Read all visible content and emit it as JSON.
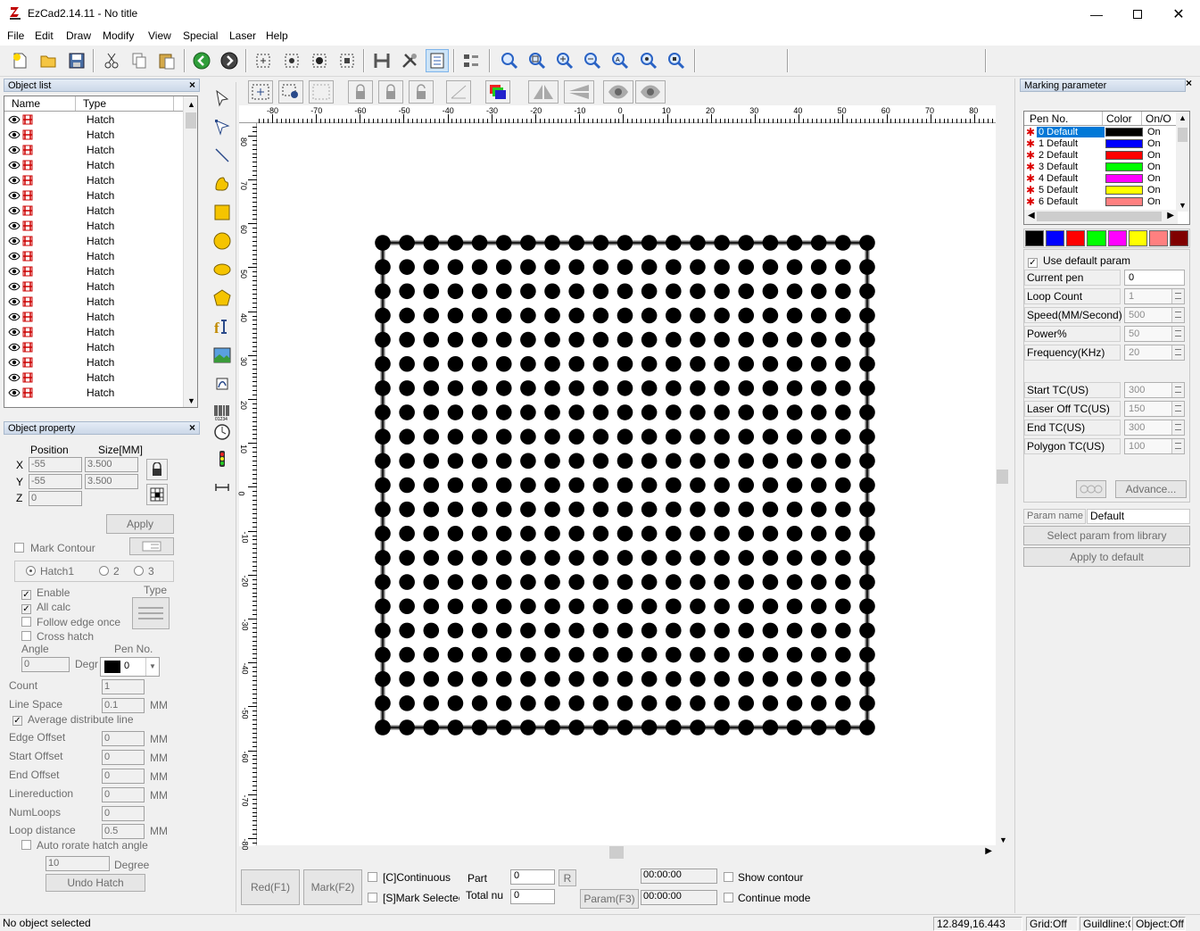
{
  "app": {
    "title": "EzCad2.14.11 - No title"
  },
  "menu": [
    "File",
    "Edit",
    "Draw",
    "Modify",
    "View",
    "Special",
    "Laser",
    "Help"
  ],
  "object_list": {
    "title": "Object list",
    "columns": [
      "Name",
      "Type"
    ],
    "rows": [
      "Hatch",
      "Hatch",
      "Hatch",
      "Hatch",
      "Hatch",
      "Hatch",
      "Hatch",
      "Hatch",
      "Hatch",
      "Hatch",
      "Hatch",
      "Hatch",
      "Hatch",
      "Hatch",
      "Hatch",
      "Hatch",
      "Hatch",
      "Hatch",
      "Hatch"
    ]
  },
  "object_property": {
    "title": "Object property",
    "position_label": "Position",
    "size_label": "Size[MM]",
    "x_label": "X",
    "y_label": "Y",
    "z_label": "Z",
    "x": "-55",
    "y": "-55",
    "z": "0",
    "w": "3.500",
    "h": "3.500",
    "apply": "Apply",
    "mark_contour": "Mark Contour",
    "hatch1": "Hatch1",
    "hatch2": "2",
    "hatch3": "3",
    "enable": "Enable",
    "all_calc": "All calc",
    "follow_edge": "Follow edge once",
    "cross_hatch": "Cross hatch",
    "type_label": "Type",
    "angle_label": "Angle",
    "angle": "0",
    "degr": "Degr",
    "pen_no_label": "Pen No.",
    "pen_no": "0",
    "count_label": "Count",
    "count": "1",
    "line_space_label": "Line Space",
    "line_space": "0.1",
    "mm": "MM",
    "avg_distribute": "Average distribute line",
    "edge_offset_label": "Edge Offset",
    "edge_offset": "0",
    "start_offset_label": "Start Offset",
    "start_offset": "0",
    "end_offset_label": "End Offset",
    "end_offset": "0",
    "linereduction_label": "Linereduction",
    "linereduction": "0",
    "numloops_label": "NumLoops",
    "numloops": "0",
    "loop_distance_label": "Loop distance",
    "loop_distance": "0.5",
    "auto_rotate": "Auto rorate hatch angle",
    "degree_value": "10",
    "degree_label": "Degree",
    "undo_hatch": "Undo Hatch"
  },
  "ruler": {
    "h_labels": [
      "-80",
      "-70",
      "-60",
      "-50",
      "-40",
      "-30",
      "-20",
      "-10",
      "0",
      "10",
      "20",
      "30",
      "40",
      "50",
      "60",
      "70",
      "80"
    ],
    "v_labels": [
      "80",
      "70",
      "60",
      "50",
      "40",
      "30",
      "20",
      "10",
      "0",
      "-10",
      "-20",
      "-30",
      "-40",
      "-50",
      "-60",
      "-70",
      "-80"
    ]
  },
  "grid": {
    "rows": 21,
    "cols": 21
  },
  "bottom_bar": {
    "red": "Red(F1)",
    "mark": "Mark(F2)",
    "continuous": "[C]Continuous",
    "mark_selected": "[S]Mark Selectec",
    "part_label": "Part",
    "part": "0",
    "total_label": "Total nu",
    "total": "0",
    "r": "R",
    "param": "Param(F3)",
    "time1": "00:00:00",
    "time2": "00:00:00",
    "show_contour": "Show contour",
    "continue_mode": "Continue mode"
  },
  "marking": {
    "title": "Marking parameter",
    "columns": [
      "Pen No.",
      "Color",
      "On/O"
    ],
    "pens": [
      {
        "no": "0",
        "name": "Default",
        "color": "#000000",
        "on": "On"
      },
      {
        "no": "1",
        "name": "Default",
        "color": "#0000ff",
        "on": "On"
      },
      {
        "no": "2",
        "name": "Default",
        "color": "#ff0000",
        "on": "On"
      },
      {
        "no": "3",
        "name": "Default",
        "color": "#00ff00",
        "on": "On"
      },
      {
        "no": "4",
        "name": "Default",
        "color": "#ff00ff",
        "on": "On"
      },
      {
        "no": "5",
        "name": "Default",
        "color": "#ffff00",
        "on": "On"
      },
      {
        "no": "6",
        "name": "Default",
        "color": "#ff8080",
        "on": "On"
      }
    ],
    "palette": [
      "#000000",
      "#0000ff",
      "#ff0000",
      "#00ff00",
      "#ff00ff",
      "#ffff00",
      "#ff8080",
      "#800000"
    ],
    "use_default": "Use default param",
    "params": [
      {
        "label": "Current pen",
        "value": "0"
      },
      {
        "label": "Loop Count",
        "value": "1"
      },
      {
        "label": "Speed(MM/Second)",
        "value": "500"
      },
      {
        "label": "Power%",
        "value": "50"
      },
      {
        "label": "Frequency(KHz)",
        "value": "20"
      },
      {
        "label": "Start TC(US)",
        "value": "300"
      },
      {
        "label": "Laser Off TC(US)",
        "value": "150"
      },
      {
        "label": "End TC(US)",
        "value": "300"
      },
      {
        "label": "Polygon TC(US)",
        "value": "100"
      }
    ],
    "advance": "Advance...",
    "param_name_label": "Param name",
    "param_name": "Default",
    "select_library": "Select param from library",
    "apply_default": "Apply to default"
  },
  "status": {
    "message": "No object selected",
    "coords": "12.849,16.443",
    "grid": "Grid:Off",
    "guideline": "Guildline:Off",
    "object": "Object:Off"
  }
}
